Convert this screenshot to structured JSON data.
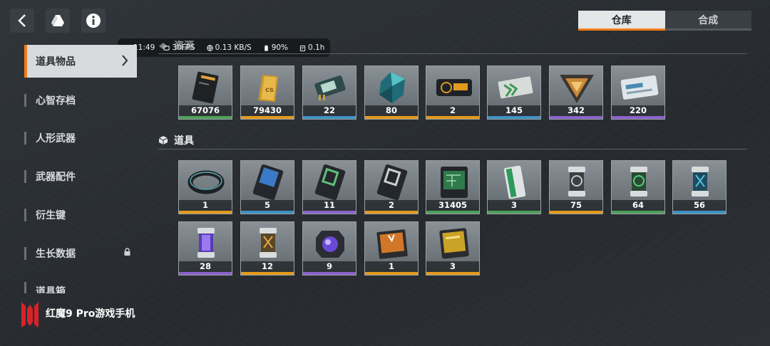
{
  "tabs": [
    {
      "label": "仓库",
      "active": true
    },
    {
      "label": "合成",
      "active": false
    }
  ],
  "status": {
    "time": "11:49",
    "fps": "30FPS",
    "net": "0.13 KB/S",
    "battery": "90%",
    "duration": "0.1h"
  },
  "sidebar": {
    "items": [
      {
        "label": "道具物品",
        "active": true
      },
      {
        "label": "心智存档"
      },
      {
        "label": "人形武器"
      },
      {
        "label": "武器配件"
      },
      {
        "label": "衍生键"
      },
      {
        "label": "生长数据",
        "locked": true
      },
      {
        "label": "道具箱"
      }
    ]
  },
  "sections": {
    "resources": "资源",
    "items": "道具"
  },
  "colors": {
    "green": "#4fa05a",
    "blue": "#3e92c2",
    "purple": "#8a62c9",
    "orange": "#e29a1d",
    "accent": "#f07d1a"
  },
  "resources": [
    {
      "count": "67076",
      "rarity": "green",
      "icon": "ticket-icon"
    },
    {
      "count": "79430",
      "rarity": "orange",
      "icon": "gold-bar-icon"
    },
    {
      "count": "22",
      "rarity": "blue",
      "icon": "chip-icon"
    },
    {
      "count": "80",
      "rarity": "orange",
      "icon": "crystal-icon"
    },
    {
      "count": "2",
      "rarity": "orange",
      "icon": "card-icon"
    },
    {
      "count": "145",
      "rarity": "blue",
      "icon": "token-icon"
    },
    {
      "count": "342",
      "rarity": "purple",
      "icon": "triangle-icon"
    },
    {
      "count": "220",
      "rarity": "purple",
      "icon": "pass-icon"
    }
  ],
  "items": [
    {
      "count": "1",
      "rarity": "orange",
      "icon": "ring-icon"
    },
    {
      "count": "5",
      "rarity": "blue",
      "icon": "datacard-icon"
    },
    {
      "count": "11",
      "rarity": "purple",
      "icon": "datacard-icon"
    },
    {
      "count": "2",
      "rarity": "orange",
      "icon": "datacard-icon"
    },
    {
      "count": "31405",
      "rarity": "green",
      "icon": "board-icon"
    },
    {
      "count": "3",
      "rarity": "green",
      "icon": "tube-icon"
    },
    {
      "count": "75",
      "rarity": "orange",
      "icon": "canister-icon"
    },
    {
      "count": "64",
      "rarity": "green",
      "icon": "canister-icon"
    },
    {
      "count": "56",
      "rarity": "blue",
      "icon": "canister-icon"
    },
    {
      "count": "28",
      "rarity": "purple",
      "icon": "canister-icon"
    },
    {
      "count": "12",
      "rarity": "orange",
      "icon": "canister-icon"
    },
    {
      "count": "9",
      "rarity": "purple",
      "icon": "orb-icon"
    },
    {
      "count": "1",
      "rarity": "orange",
      "icon": "package-icon"
    },
    {
      "count": "3",
      "rarity": "orange",
      "icon": "gold-card-icon"
    }
  ],
  "brand": {
    "text": "红魔9 Pro游戏手机"
  }
}
